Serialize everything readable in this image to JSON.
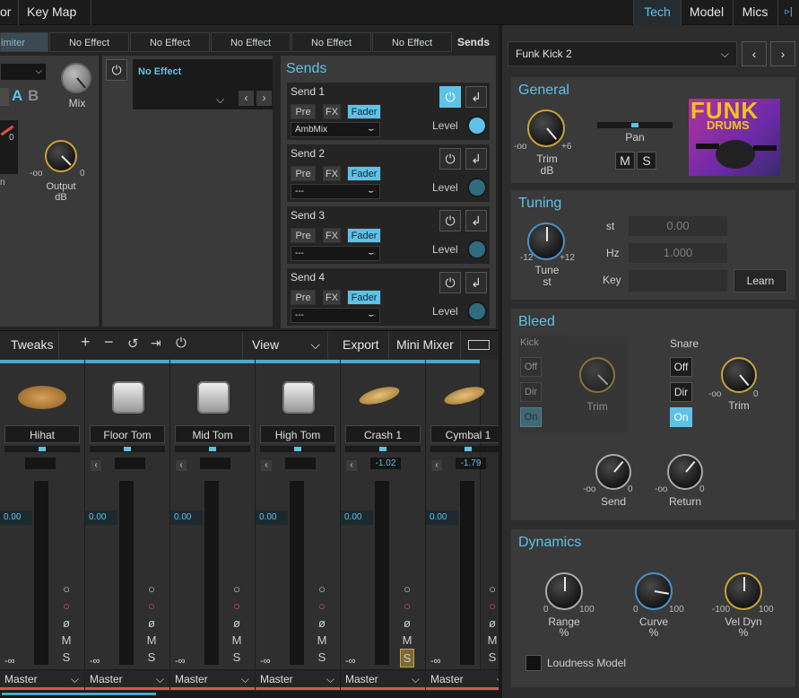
{
  "topbar": {
    "left_items": [
      "or",
      "Key Map"
    ],
    "right_items": [
      "Tech",
      "Model",
      "Mics"
    ],
    "right_icon": "collapse-panel-icon"
  },
  "fx_row": {
    "first_slot": "imiter",
    "slots": [
      "No Effect",
      "No Effect",
      "No Effect",
      "No Effect",
      "No Effect"
    ],
    "sends_label": "Sends"
  },
  "effect": {
    "ab_a": "A",
    "ab_b": "B",
    "mix_label": "Mix",
    "knob_dash": "-oo",
    "knob_zero": "0",
    "output_label": "Output",
    "output_unit": "dB",
    "output_min": "-oo",
    "output_max": "0",
    "left_cut": "n",
    "slot_name": "No Effect"
  },
  "sends": {
    "title": "Sends",
    "items": [
      {
        "name": "Send 1",
        "pre": "Pre",
        "fx": "FX",
        "fader": "Fader",
        "dest": "AmbMix",
        "level": "Level"
      },
      {
        "name": "Send 2",
        "pre": "Pre",
        "fx": "FX",
        "fader": "Fader",
        "dest": "---",
        "level": "Level"
      },
      {
        "name": "Send 3",
        "pre": "Pre",
        "fx": "FX",
        "fader": "Fader",
        "dest": "---",
        "level": "Level"
      },
      {
        "name": "Send 4",
        "pre": "Pre",
        "fx": "FX",
        "fader": "Fader",
        "dest": "---",
        "level": "Level"
      }
    ]
  },
  "toolbar": {
    "tweaks": "Tweaks",
    "view": "View",
    "export": "Export",
    "mini_mixer": "Mini Mixer"
  },
  "channels": [
    {
      "name": "Hihat",
      "gain": "",
      "value": "0.00",
      "out": "Master"
    },
    {
      "name": "Floor Tom",
      "gain": "",
      "value": "0.00",
      "out": "Master"
    },
    {
      "name": "Mid Tom",
      "gain": "",
      "value": "0.00",
      "out": "Master"
    },
    {
      "name": "High Tom",
      "gain": "",
      "value": "0.00",
      "out": "Master"
    },
    {
      "name": "Crash 1",
      "gain": "-1.02",
      "value": "0.00",
      "out": "Master"
    },
    {
      "name": "Cymbal 1",
      "gain": "-1.79",
      "value": "0.00",
      "out": "Master"
    }
  ],
  "channel_btn_m": "M",
  "channel_btn_s": "S",
  "channel_btn_phase": "ø",
  "minus_inf": "-∞",
  "instrument": {
    "name": "Funk Kick 2"
  },
  "general": {
    "title": "General",
    "trim_label": "Trim",
    "trim_unit": "dB",
    "trim_min": "-oo",
    "trim_max": "+6",
    "pan_label": "Pan",
    "m": "M",
    "s": "S",
    "art_line1": "FUNK",
    "art_line2": "DRUMS"
  },
  "tuning": {
    "title": "Tuning",
    "tune_label": "Tune",
    "tune_unit": "st",
    "tune_min": "-12",
    "tune_max": "+12",
    "st_label": "st",
    "st_value": "0.00",
    "hz_label": "Hz",
    "hz_value": "1.000",
    "key_label": "Key",
    "key_value": "",
    "learn": "Learn"
  },
  "bleed": {
    "title": "Bleed",
    "kick_label": "Kick",
    "off": "Off",
    "dir": "Dir",
    "on": "On",
    "trim": "Trim",
    "snare_label": "Snare",
    "knob_min": "-oo",
    "knob_max": "0",
    "send": "Send",
    "return": "Return"
  },
  "dynamics": {
    "title": "Dynamics",
    "range": "Range",
    "curve": "Curve",
    "veldyn": "Vel Dyn",
    "pct": "%",
    "range_min": "0",
    "range_max": "100",
    "curve_min": "0",
    "curve_max": "100",
    "vel_min": "-100",
    "vel_max": "100",
    "loudness": "Loudness Model"
  }
}
